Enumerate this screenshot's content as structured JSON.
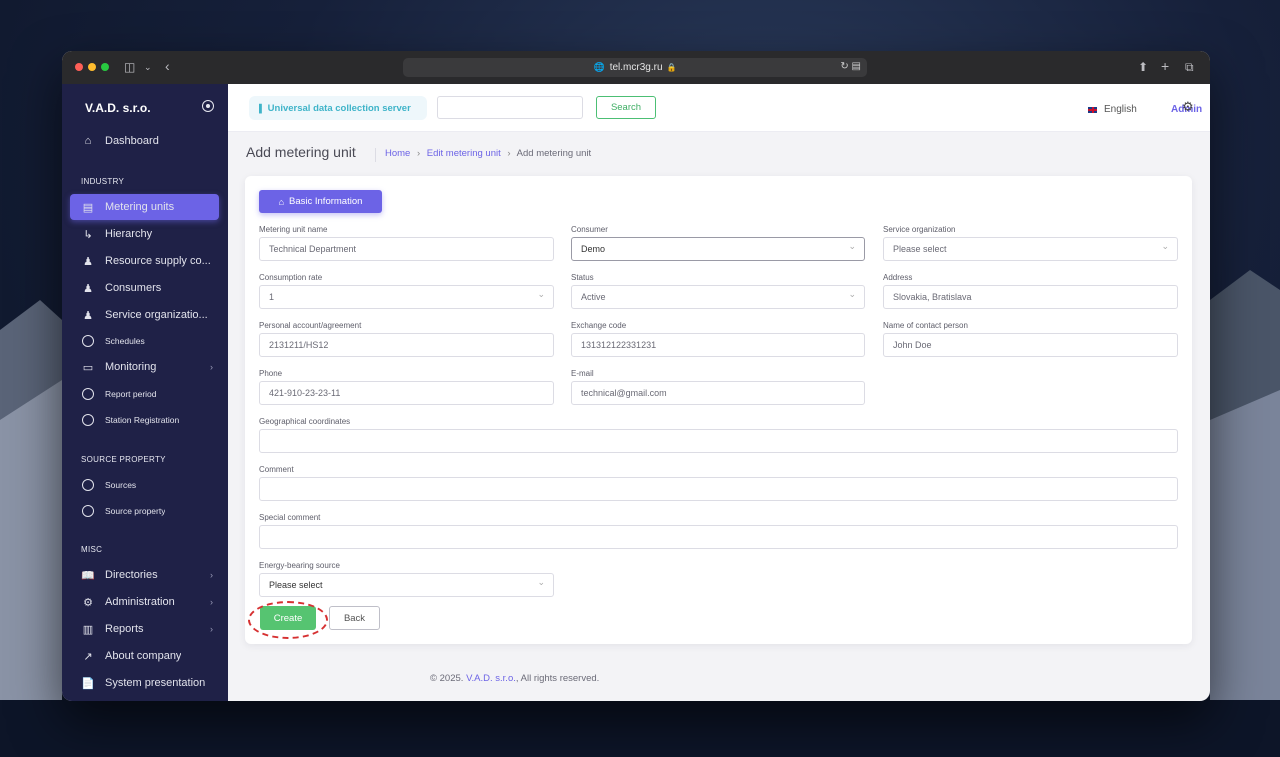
{
  "browser": {
    "url": "tel.mcr3g.ru"
  },
  "sidebar": {
    "brand": "V.A.D. s.r.o.",
    "sections": {
      "industry": "INDUSTRY",
      "source_property": "SOURCE PROPERTY",
      "misc": "MISC"
    },
    "items": [
      {
        "label": "Dashboard",
        "icon": "home-icon"
      },
      {
        "label": "Metering units",
        "icon": "server-icon",
        "active": true
      },
      {
        "label": "Hierarchy",
        "icon": "arrow-down-right-icon"
      },
      {
        "label": "Resource supply co...",
        "icon": "users-icon"
      },
      {
        "label": "Consumers",
        "icon": "users-icon"
      },
      {
        "label": "Service organizatio...",
        "icon": "users-icon"
      },
      {
        "label": "Schedules",
        "icon": "circle-icon"
      },
      {
        "label": "Monitoring",
        "icon": "monitor-icon"
      },
      {
        "label": "Report period",
        "icon": "circle-icon"
      },
      {
        "label": "Station Registration",
        "icon": "circle-icon"
      },
      {
        "label": "Sources",
        "icon": "circle-icon"
      },
      {
        "label": "Source property",
        "icon": "circle-icon"
      },
      {
        "label": "Directories",
        "icon": "book-icon"
      },
      {
        "label": "Administration",
        "icon": "gear-icon"
      },
      {
        "label": "Reports",
        "icon": "bar-chart-icon"
      },
      {
        "label": "About company",
        "icon": "external-link-icon"
      },
      {
        "label": "System presentation",
        "icon": "file-icon"
      }
    ]
  },
  "topbar": {
    "server_label": "Universal data collection server",
    "search_placeholder": "",
    "search_button": "Search",
    "language": "English",
    "user": "Admin"
  },
  "page": {
    "title": "Add metering unit",
    "breadcrumb": [
      "Home",
      "Edit metering unit",
      "Add metering unit"
    ]
  },
  "form": {
    "tab": "Basic Information",
    "fields": {
      "metering_unit_name": {
        "label": "Metering unit name",
        "value": "Technical Department"
      },
      "consumer": {
        "label": "Consumer",
        "value": "Demo"
      },
      "service_organization": {
        "label": "Service organization",
        "value": "Please select"
      },
      "consumption_rate": {
        "label": "Consumption rate",
        "value": "1"
      },
      "status": {
        "label": "Status",
        "value": "Active"
      },
      "address": {
        "label": "Address",
        "value": "Slovakia, Bratislava"
      },
      "personal_account": {
        "label": "Personal account/agreement",
        "value": "2131211/HS12"
      },
      "exchange_code": {
        "label": "Exchange code",
        "value": "131312122331231"
      },
      "contact_person": {
        "label": "Name of contact person",
        "value": "John Doe"
      },
      "phone": {
        "label": "Phone",
        "value": "421-910-23-23-11"
      },
      "email": {
        "label": "E-mail",
        "value": "technical@gmail.com"
      },
      "geo_coordinates": {
        "label": "Geographical coordinates",
        "value": ""
      },
      "comment": {
        "label": "Comment",
        "value": ""
      },
      "special_comment": {
        "label": "Special comment",
        "value": ""
      },
      "energy_source": {
        "label": "Energy-bearing source",
        "value": "Please select"
      }
    },
    "create_button": "Create",
    "back_button": "Back"
  },
  "footer": {
    "prefix": "© 2025.",
    "company": "V.A.D. s.r.o.",
    "suffix": ", All rights reserved."
  },
  "colors": {
    "accent": "#6c63e6",
    "sidebar_bg": "#1f2147",
    "success": "#56c471",
    "highlight_ring": "#d63031"
  }
}
